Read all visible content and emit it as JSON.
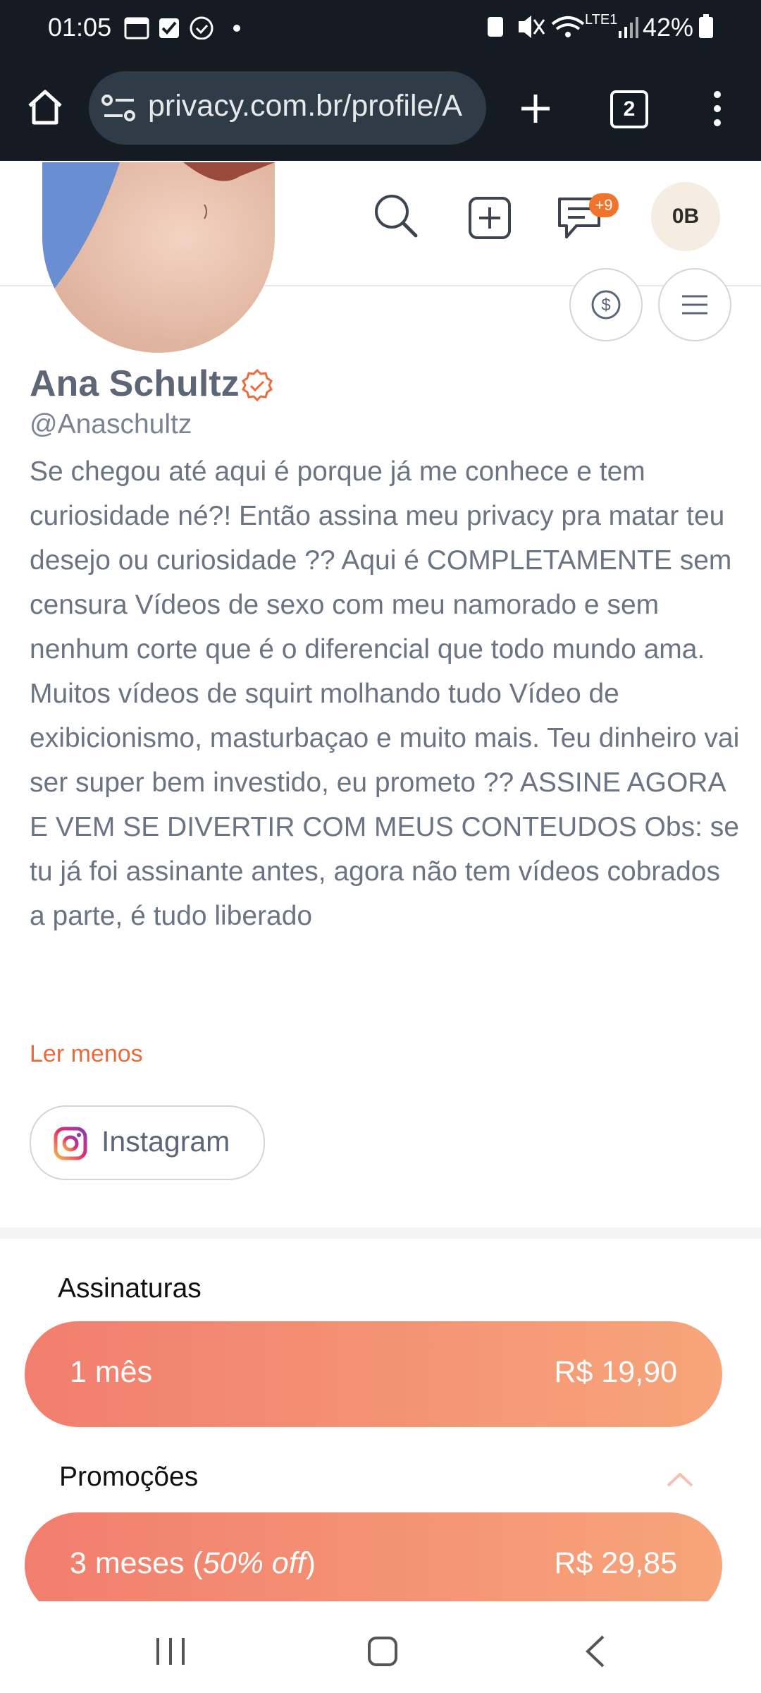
{
  "status_bar": {
    "time": "01:05",
    "network": "LTE1",
    "battery": "42%"
  },
  "browser": {
    "url": "privacy.com.br/profile/A",
    "tab_count": "2"
  },
  "header": {
    "messages_badge": "+9",
    "user_initials": "0B"
  },
  "profile": {
    "name": "Ana Schultz",
    "handle": "@Anaschultz",
    "bio": "Se chegou até aqui é porque já me conhece e tem curiosidade né?! Então assina meu privacy pra matar teu desejo ou curiosidade ?? Aqui é COMPLETAMENTE sem censura Vídeos de sexo com meu namorado e sem nenhum corte que é o diferencial que todo mundo ama. Muitos vídeos de squirt molhando tudo Vídeo de exibicionismo, masturbaçao e muito mais. Teu dinheiro vai ser super bem investido, eu prometo ?? ASSINE AGORA E VEM SE DIVERTIR COM MEUS CONTEUDOS Obs: se tu já foi assinante antes, agora não tem vídeos cobrados a parte, é tudo liberado",
    "read_less": "Ler menos",
    "instagram_label": "Instagram"
  },
  "subscriptions": {
    "title": "Assinaturas",
    "plan_1_label": "1 mês",
    "plan_1_price": "R$ 19,90"
  },
  "promotions": {
    "title": "Promoções",
    "plan_label_prefix": "3 meses (",
    "plan_discount": "50% off",
    "plan_label_suffix": ")",
    "plan_price": "R$ 29,85"
  },
  "colors": {
    "brand_orange": "#f0742c",
    "plan_gradient_start": "#f17e6e",
    "plan_gradient_end": "#f7a57a",
    "chrome_bg": "#141b22"
  }
}
